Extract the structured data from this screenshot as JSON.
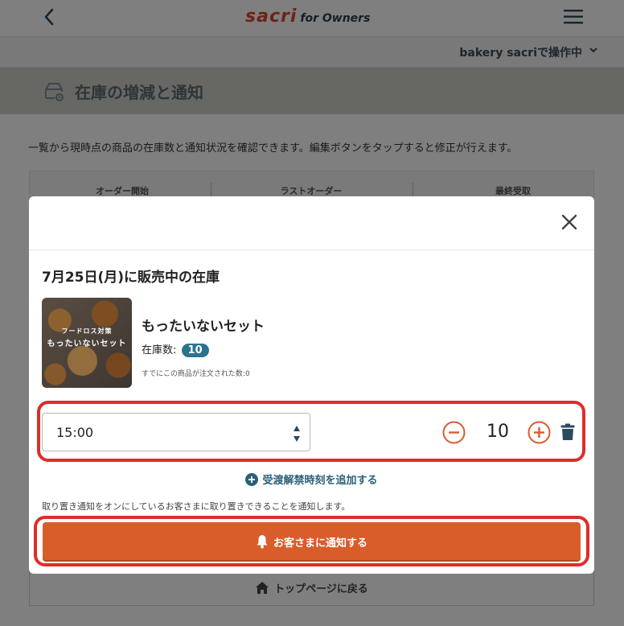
{
  "header": {
    "logo_brand": "sacri",
    "logo_suffix": "for Owners",
    "operator": "bakery sacriで操作中"
  },
  "page": {
    "title": "在庫の増減と通知",
    "description": "一覧から現時点の商品の在庫数と通知状況を確認できます。編集ボタンをタップすると修正が行えます。",
    "table_headers": [
      "オーダー開始",
      "ラストオーダー",
      "最終受取"
    ],
    "back_to_top": "トップページに戻る"
  },
  "modal": {
    "sale_title": "7月25日(月)に販売中の在庫",
    "product": {
      "image_line1": "フードロス対策",
      "image_line2": "もったいないセット",
      "name": "もったいないセット",
      "stock_label": "在庫数:",
      "stock_value": "10",
      "ordered_text": "すでにこの商品が注文された数:0"
    },
    "time_slot": {
      "time": "15:00",
      "quantity": "10"
    },
    "add_time_label": "受渡解禁時刻を追加する",
    "notify_description": "取り置き通知をオンにしているお客さまに取り置きできることを通知します。",
    "notify_button": "お客さまに通知する"
  },
  "colors": {
    "accent_orange": "#d95c2b",
    "highlight_red": "#e02c28",
    "badge_teal": "#2a7490",
    "link_blue": "#2a6078"
  }
}
